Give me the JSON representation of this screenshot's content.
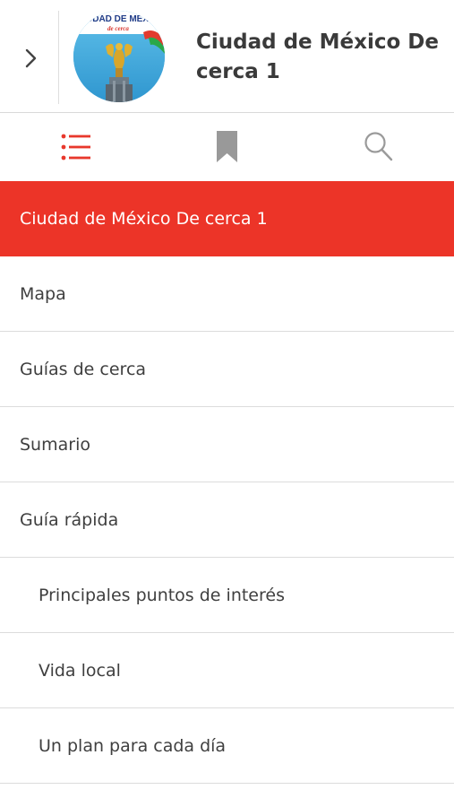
{
  "header": {
    "book_title": "Ciudad de México De cerca 1",
    "cover_text_top": "UDAD DE MÉXI",
    "cover_text_sub": "de cerca"
  },
  "tabs": {
    "active_color": "#e8382c",
    "inactive_color": "#999999",
    "items": [
      {
        "icon": "list-icon",
        "active": true
      },
      {
        "icon": "bookmark-icon",
        "active": false
      },
      {
        "icon": "search-icon",
        "active": false
      }
    ]
  },
  "toc": {
    "items": [
      {
        "label": "Ciudad de México De cerca 1",
        "level": 0,
        "active": true
      },
      {
        "label": "Mapa",
        "level": 0,
        "active": false
      },
      {
        "label": "Guías de cerca",
        "level": 0,
        "active": false
      },
      {
        "label": "Sumario",
        "level": 0,
        "active": false
      },
      {
        "label": "Guía rápida",
        "level": 0,
        "active": false
      },
      {
        "label": "Principales puntos de interés",
        "level": 1,
        "active": false
      },
      {
        "label": "Vida local",
        "level": 1,
        "active": false
      },
      {
        "label": "Un plan para cada día",
        "level": 1,
        "active": false
      }
    ]
  },
  "colors": {
    "accent": "#ec3428",
    "divider": "#dcdcdc"
  }
}
